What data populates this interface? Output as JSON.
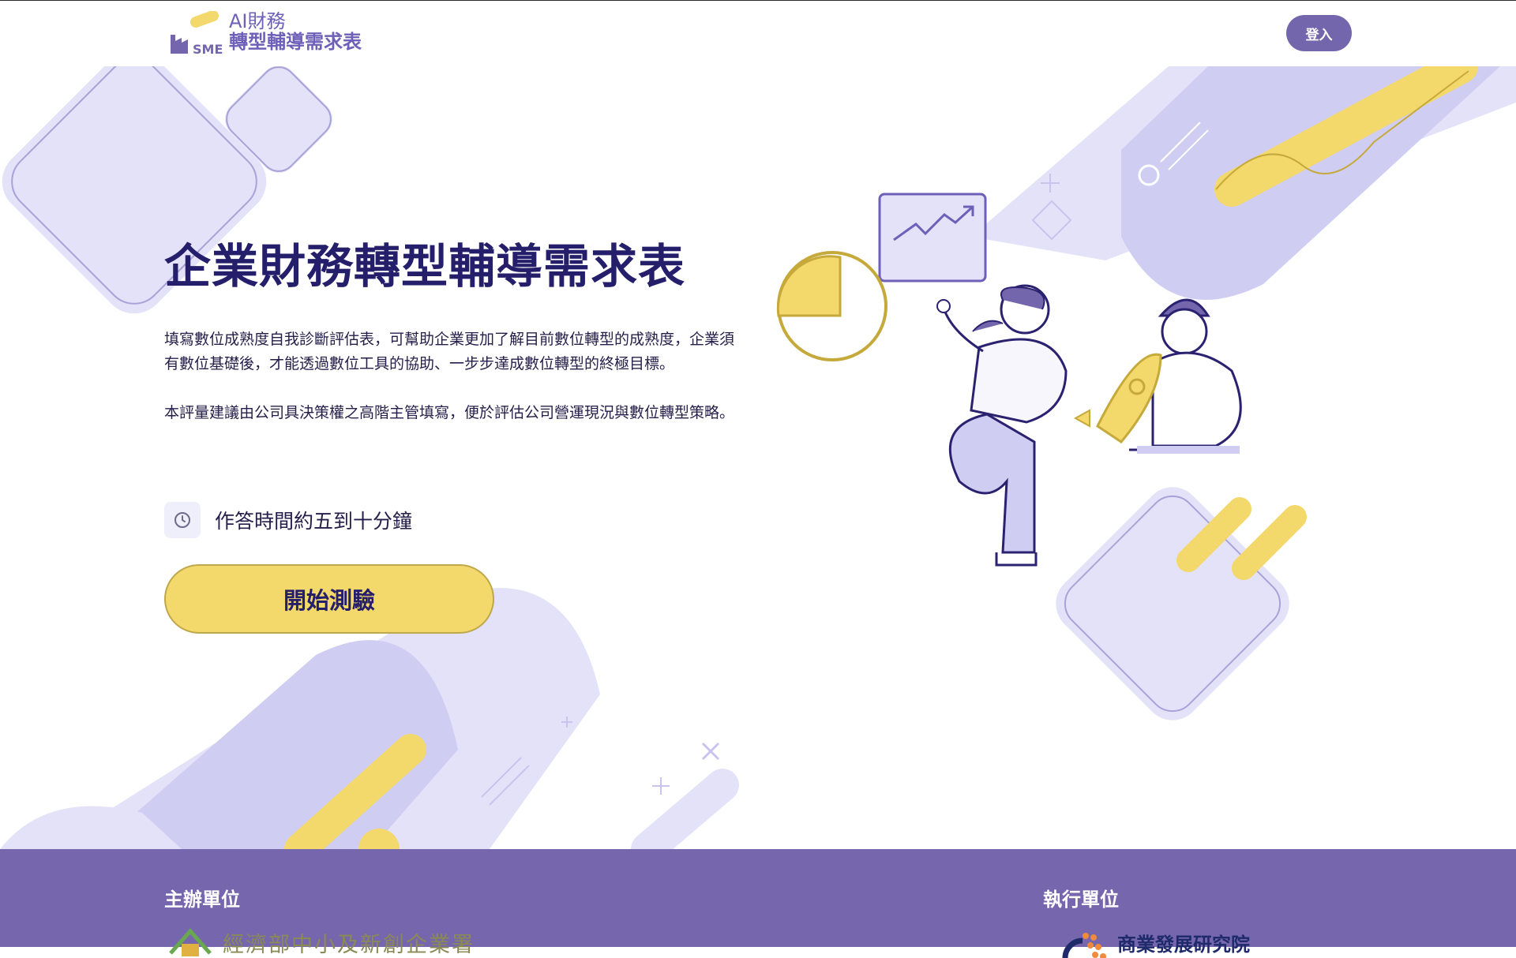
{
  "header": {
    "logo_line1": "AI財務",
    "logo_line2": "轉型輔導需求表",
    "logo_badge": "SME",
    "login_label": "登入"
  },
  "hero": {
    "title": "企業財務轉型輔導需求表",
    "paragraph1": "填寫數位成熟度自我診斷評估表，可幫助企業更加了解目前數位轉型的成熟度，企業須有數位基礎後，才能透過數位工具的協助、一步步達成數位轉型的終極目標。",
    "paragraph2": "本評量建議由公司具決策權之高階主管填寫，便於評估公司營運現況與數位轉型策略。",
    "time_text": "作答時間約五到十分鐘",
    "start_label": "開始測驗"
  },
  "footer": {
    "organizer_label": "主辦單位",
    "organizer_name": "經濟部中小及新創企業署",
    "executor_label": "執行單位",
    "executor_name": "商業發展研究院"
  },
  "colors": {
    "primary_purple": "#7466ad",
    "light_lavender": "#e4e2f8",
    "mid_lavender": "#d0cdf3",
    "accent_yellow": "#f3d86b",
    "title_navy": "#241e6b"
  },
  "icons": [
    "logo-factory-icon",
    "clock-icon",
    "org-logo-icon",
    "bdri-logo-icon"
  ]
}
